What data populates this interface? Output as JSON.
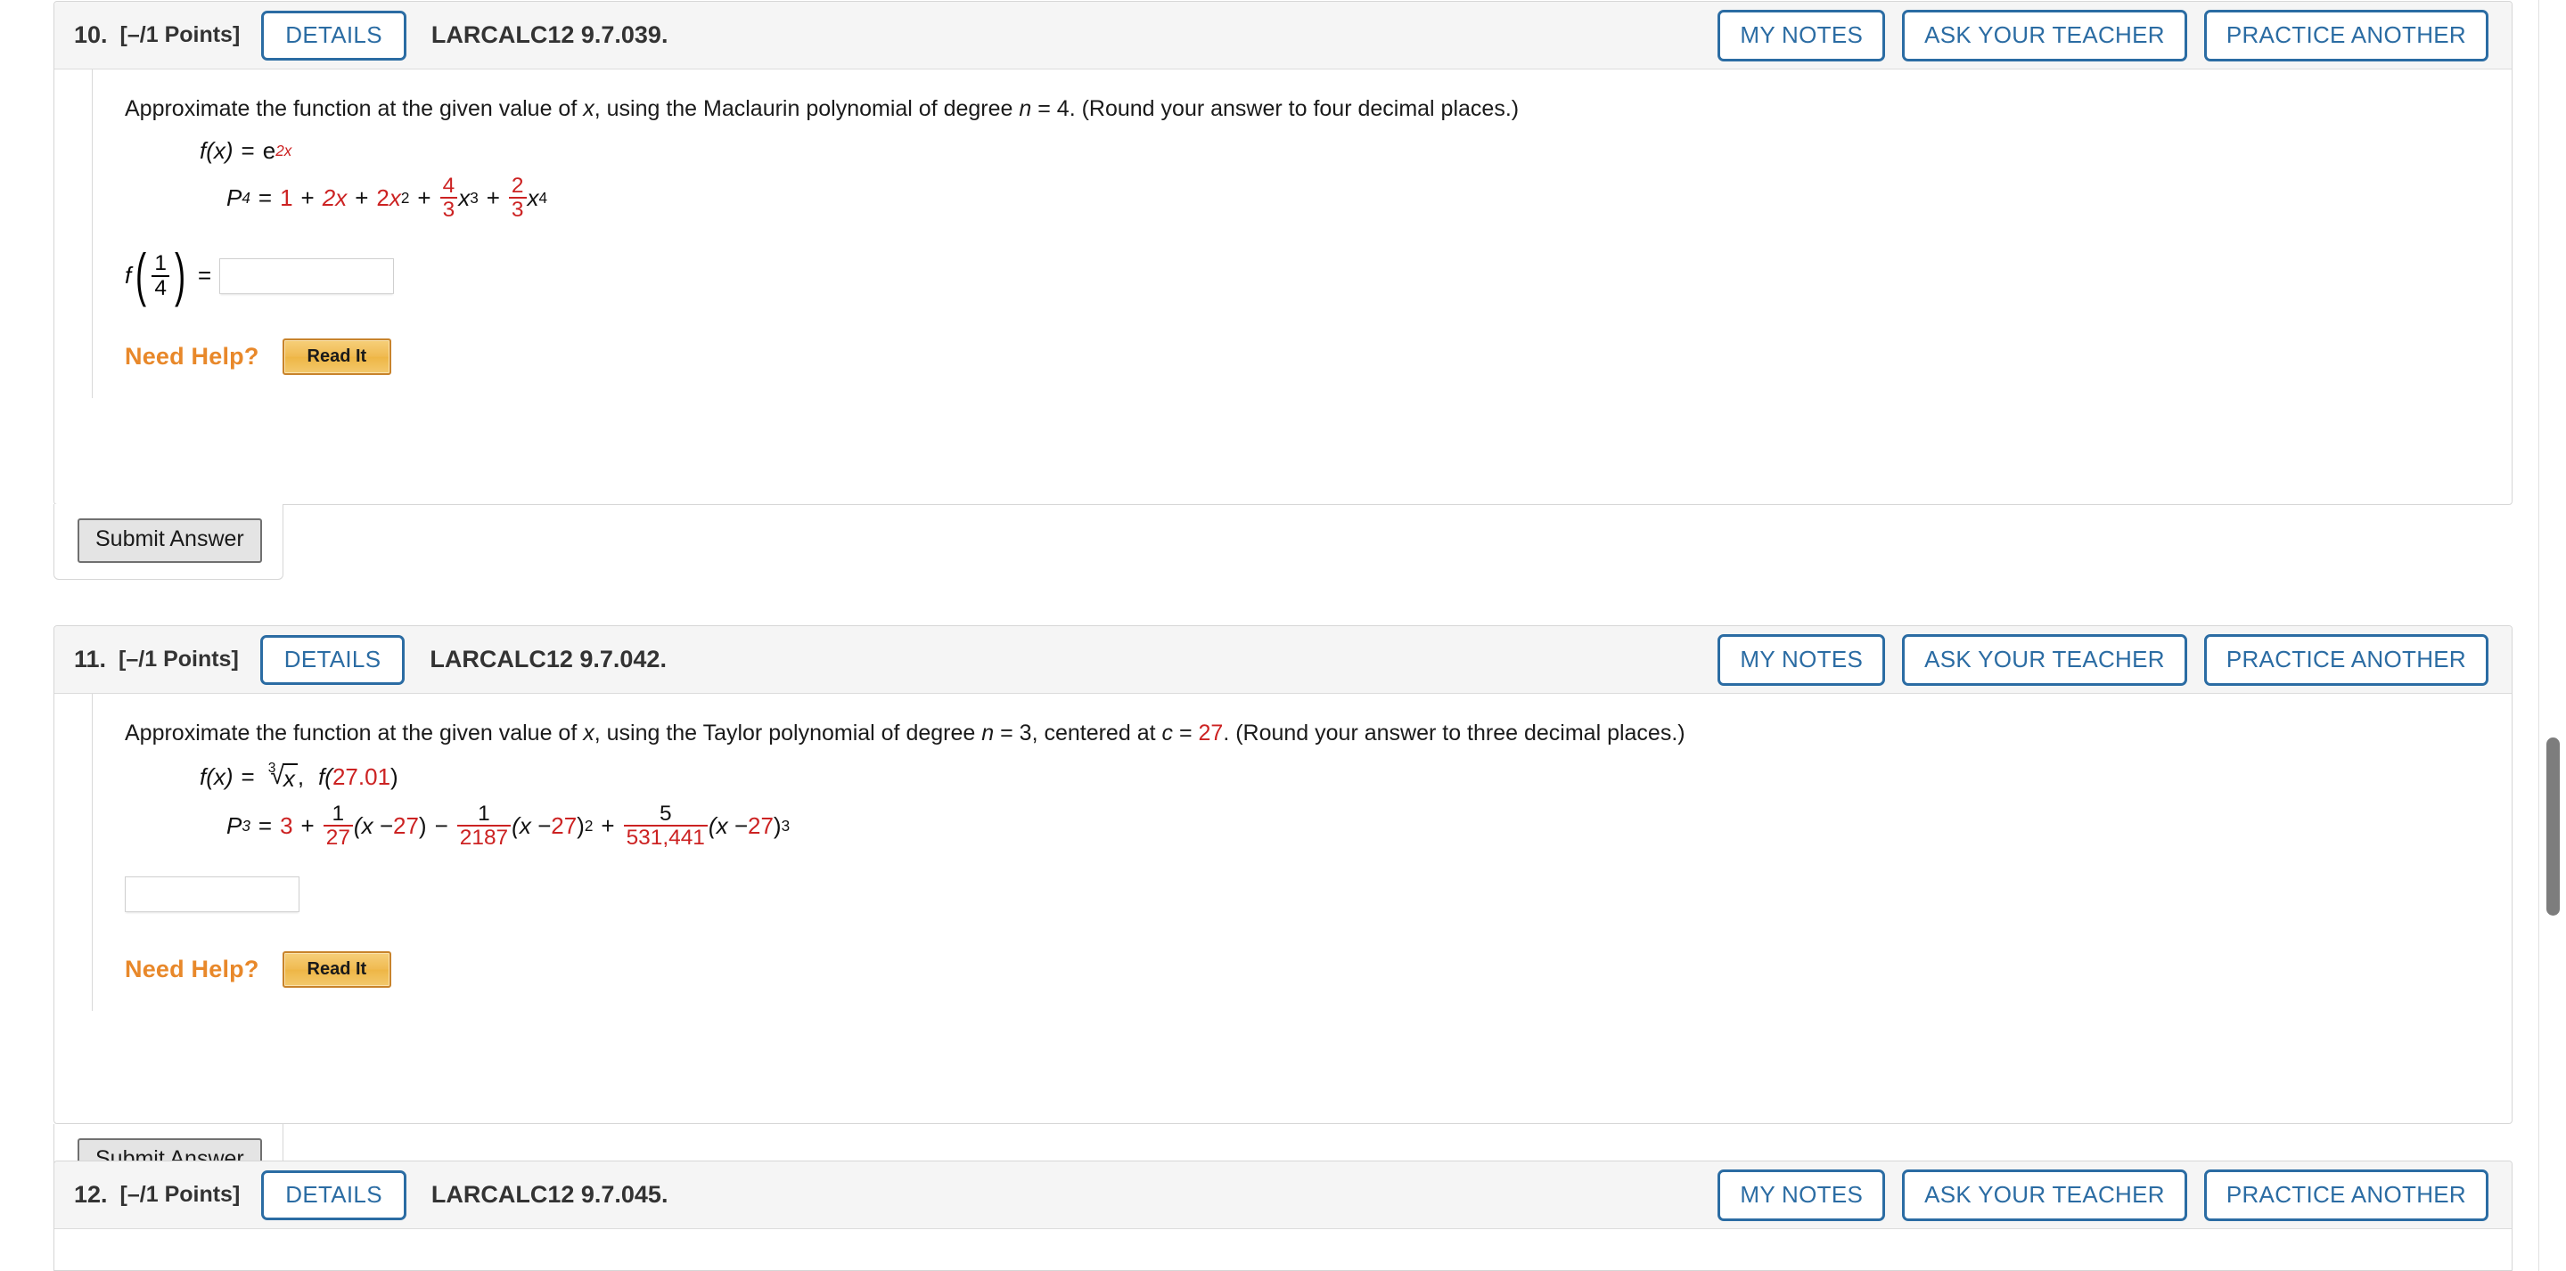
{
  "app": {
    "accent_blue": "#2b6ca3",
    "accent_red": "#cc2222",
    "accent_orange": "#e8882a",
    "header_bg": "#f5f5f5"
  },
  "common": {
    "details_label": "DETAILS",
    "my_notes_label": "MY NOTES",
    "ask_your_teacher_label": "ASK YOUR TEACHER",
    "practice_another_label": "PRACTICE ANOTHER",
    "need_help_label": "Need Help?",
    "read_it_label": "Read It",
    "submit_label": "Submit Answer",
    "points_label": "[–/1 Points]"
  },
  "questions": [
    {
      "number": "10.",
      "points": "[–/1 Points]",
      "code": "LARCALC12 9.7.039.",
      "prompt": {
        "part1": "Approximate the function at the given value of ",
        "var_x": "x",
        "part2": ", using the Maclaurin polynomial of degree ",
        "var_n": "n",
        "eq": " = ",
        "degree": "4",
        "part3": ". (Round your answer to four decimal places.)"
      },
      "math": {
        "fx_label": "f(x)",
        "equals": "=",
        "fx_base": "e",
        "fx_exponent": "2x",
        "poly_label": "P",
        "poly_sub": "4",
        "terms": {
          "t0": "1",
          "plus1": "+",
          "t1": "2x",
          "plus2": "+",
          "t2_coef": "2",
          "t2_var": "x",
          "t2_pow": "2",
          "plus3": "+",
          "t3_num": "4",
          "t3_den": "3",
          "t3_var": "x",
          "t3_pow": "3",
          "plus4": "+",
          "t4_num": "2",
          "t4_den": "3",
          "t4_var": "x",
          "t4_pow": "4"
        }
      },
      "answer": {
        "f_label": "f",
        "arg_num": "1",
        "arg_den": "4",
        "equals": "=",
        "value": "",
        "placeholder": ""
      }
    },
    {
      "number": "11.",
      "points": "[–/1 Points]",
      "code": "LARCALC12 9.7.042.",
      "prompt": {
        "part1": "Approximate the function at the given value of ",
        "var_x": "x",
        "part2": ", using the Taylor polynomial of degree ",
        "var_n": "n",
        "eq": " = ",
        "degree": "3",
        "part2b": ", centered at ",
        "var_c": "c",
        "eq2": " = ",
        "center": "27",
        "part3": ". (Round your answer to three decimal places.)"
      },
      "math": {
        "fx_label": "f(x)",
        "equals": "=",
        "root_index": "3",
        "root_radicand": "x",
        "comma": ",",
        "eval_label": "f(",
        "eval_value": "27.01",
        "eval_close": ")",
        "poly_label": "P",
        "poly_sub": "3",
        "terms": {
          "t0": "3",
          "plus1": "+",
          "t1_num": "1",
          "t1_den": "27",
          "t1_open": "(x − ",
          "t1_center": "27",
          "t1_close": ")",
          "minus": "−",
          "t2_num": "1",
          "t2_den": "2187",
          "t2_open": "(x − ",
          "t2_center": "27",
          "t2_close": ")",
          "t2_pow": "2",
          "plus2": "+",
          "t3_num": "5",
          "t3_den": "531,441",
          "t3_open": "(x − ",
          "t3_center": "27",
          "t3_close": ")",
          "t3_pow": "3"
        }
      },
      "answer": {
        "value": "",
        "placeholder": ""
      }
    },
    {
      "number": "12.",
      "points": "[–/1 Points]",
      "code": "LARCALC12 9.7.045."
    }
  ]
}
